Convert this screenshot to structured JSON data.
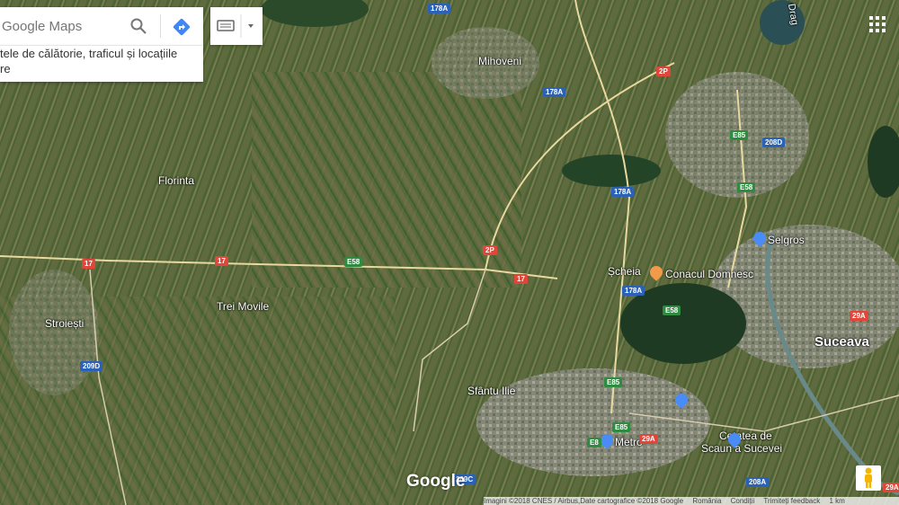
{
  "search": {
    "placeholder": "Google Maps",
    "suggest_line1": "tele de călătorie, traficul și locațiile",
    "suggest_line2": "re"
  },
  "places": [
    {
      "name": "Mihoveni"
    },
    {
      "name": "Florinta"
    },
    {
      "name": "Trei Movile"
    },
    {
      "name": "Stroiești"
    },
    {
      "name": "Sfântu Ilie"
    },
    {
      "name": "Șcheia"
    },
    {
      "name": "Conacul Domnesc"
    },
    {
      "name": "Selgros"
    },
    {
      "name": "Suceava"
    },
    {
      "name": "Metro"
    },
    {
      "name": "Cetatea de"
    },
    {
      "name": "Scaun a Sucevei"
    },
    {
      "name": "Drag"
    }
  ],
  "roads": [
    "178A",
    "2P",
    "178A",
    "E85",
    "208D",
    "E58",
    "178A",
    "2P",
    "17",
    "17",
    "E58",
    "17",
    "178A",
    "E58",
    "209D",
    "E85",
    "E85",
    "E8",
    "29A",
    "29A",
    "209C",
    "208A",
    "29A"
  ],
  "footer": {
    "imagery": "Imagini ©2018 CNES / Airbus,Date cartografice ©2018 Google",
    "country": "România",
    "terms": "Condiții",
    "feedback": "Trimiteți feedback",
    "scale": "1 km"
  },
  "logo": "Google",
  "colors": {
    "accent": "#4285f4",
    "pin_orange": "#f2994a",
    "pin_blue": "#4a8cf5",
    "shield_red": "#e0463a",
    "shield_blue": "#2b62b6",
    "shield_green": "#2e8b3f"
  }
}
